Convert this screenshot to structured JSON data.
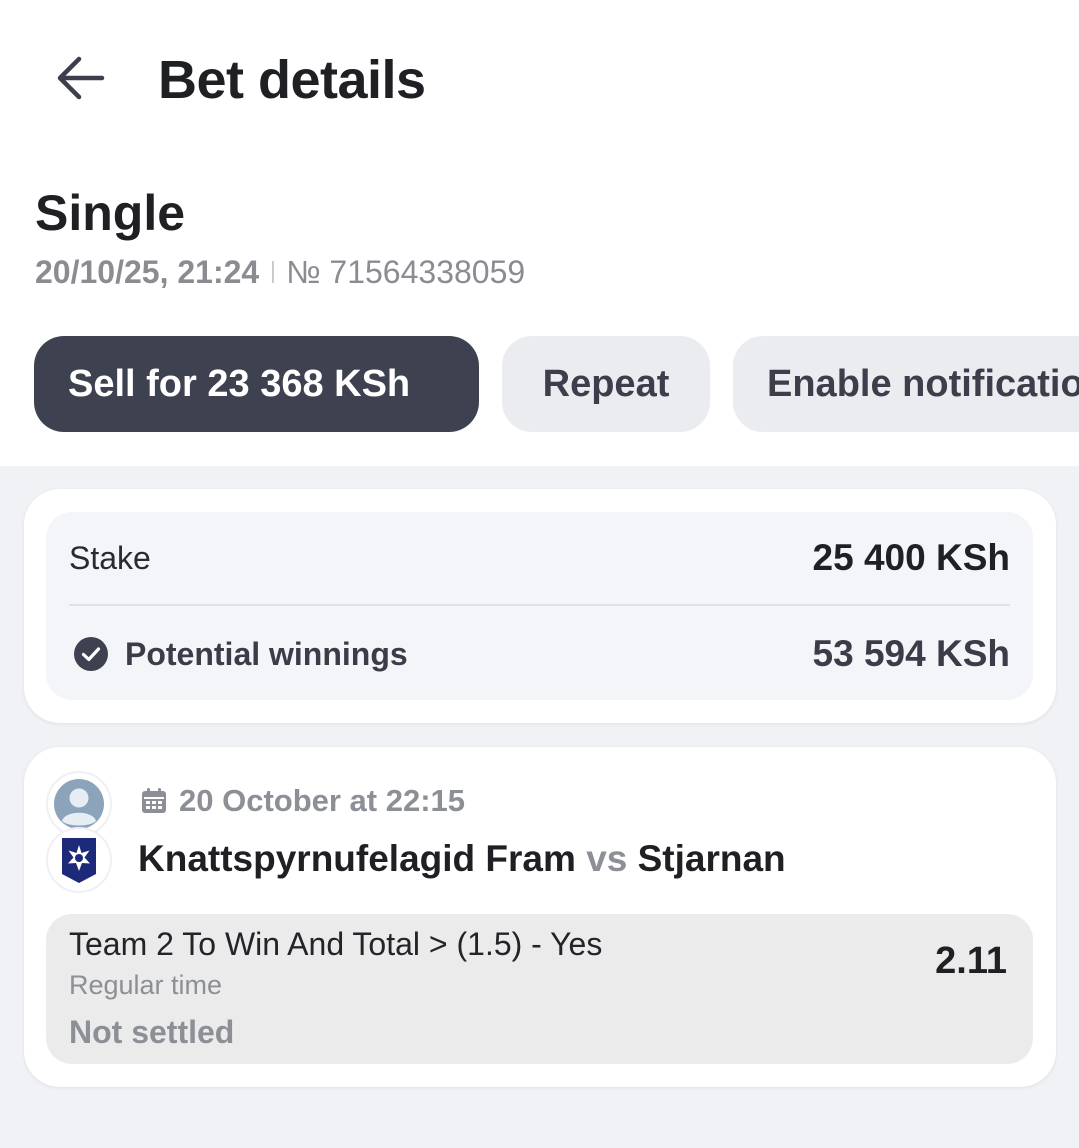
{
  "header": {
    "title": "Bet details"
  },
  "bet": {
    "type": "Single",
    "date": "20/10/25, 21:24",
    "number": "№ 71564338059"
  },
  "actions": {
    "sell_label": "Sell for 23 368 KSh",
    "repeat_label": "Repeat",
    "notifications_label": "Enable notifications"
  },
  "summary": {
    "stake_label": "Stake",
    "stake_value": "25 400 KSh",
    "winnings_label": "Potential winnings",
    "winnings_value": "53 594 KSh"
  },
  "event": {
    "date": "20 October at 22:15",
    "team1": "Knattspyrnufelagid Fram",
    "vs": "vs",
    "team2": "Stjarnan",
    "market": "Team 2 To Win And Total > (1.5) - Yes",
    "period": "Regular time",
    "status": "Not settled",
    "odds": "2.11"
  },
  "icons": {
    "back": "arrow-left-icon",
    "check": "check-circle-icon",
    "calendar": "calendar-icon",
    "home_logo": "placeholder-team-logo",
    "away_logo": "stjarnan-crest"
  },
  "colors": {
    "primary_button": "#3e4250",
    "secondary_button": "#ebecef",
    "page_background": "#f1f2f5",
    "muted_text": "#8c8f96"
  }
}
